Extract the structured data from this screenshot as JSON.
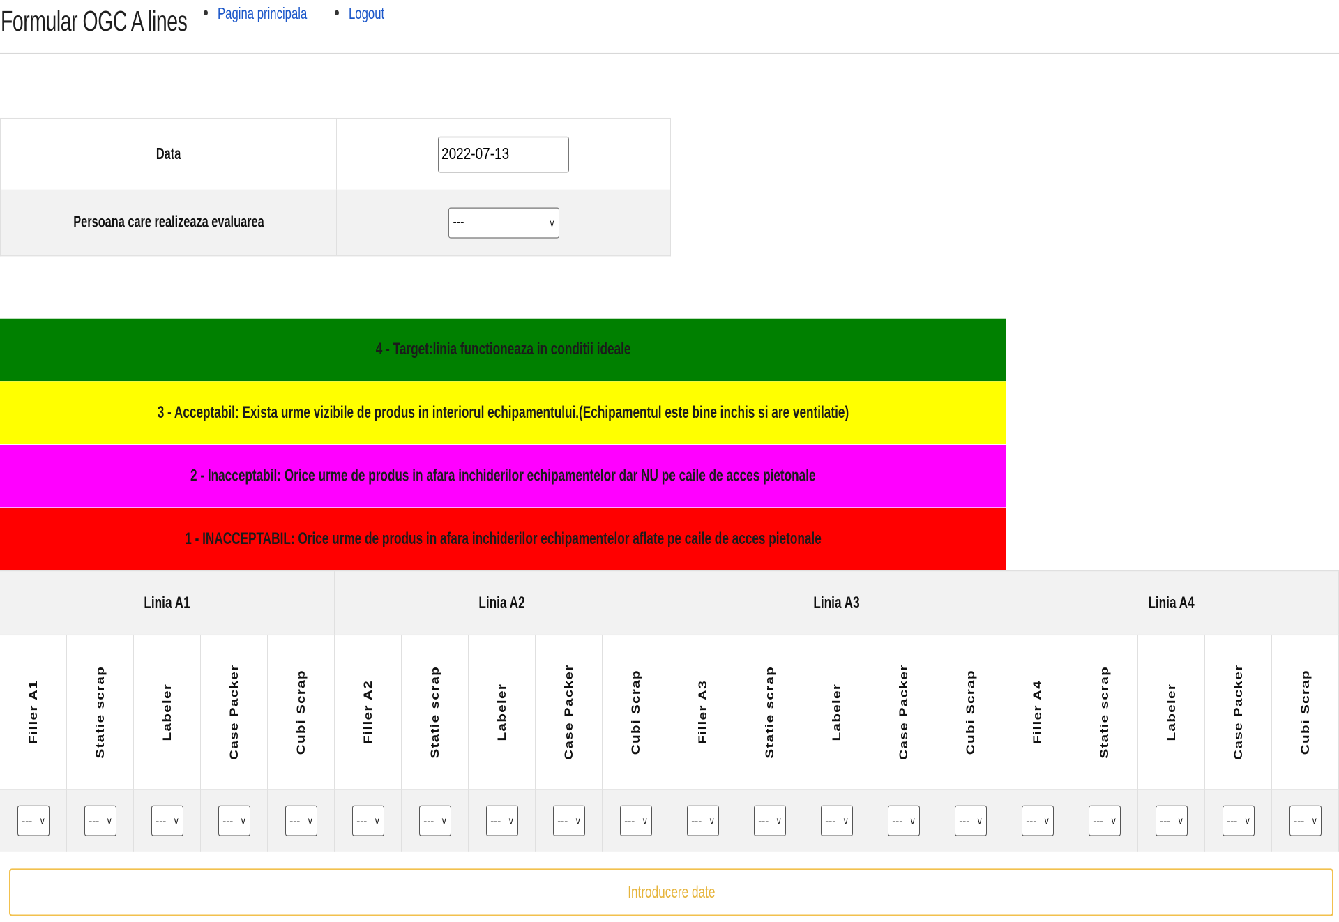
{
  "header": {
    "title": "Formular OGC A lines",
    "nav": [
      {
        "label": "Pagina principala"
      },
      {
        "label": "Logout"
      }
    ]
  },
  "form": {
    "date_label": "Data",
    "date_value": "2022-07-13",
    "person_label": "Persoana care realizeaza evaluarea",
    "person_selected": "---"
  },
  "legend": [
    {
      "text": "4 - Target:linia functioneaza in conditii ideale",
      "color": "#008000"
    },
    {
      "text": "3 - Acceptabil: Exista urme vizibile de produs in interiorul echipamentului.(Echipamentul este bine inchis si are ventilatie)",
      "color": "#ffff00"
    },
    {
      "text": "2 - Inacceptabil: Orice urme de produs in afara inchiderilor echipamentelor dar NU pe caile de acces pietonale",
      "color": "#ff00ff"
    },
    {
      "text": "1 - INACCEPTABIL: Orice urme de produs in afara inchiderilor echipamentelor aflate pe caile de acces pietonale",
      "color": "#ff0000"
    }
  ],
  "lines": [
    {
      "name": "Linia A1",
      "columns": [
        "Filler A1",
        "Statie scrap",
        "Labeler",
        "Case Packer",
        "Cubi Scrap"
      ]
    },
    {
      "name": "Linia A2",
      "columns": [
        "Filler A2",
        "Statie scrap",
        "Labeler",
        "Case Packer",
        "Cubi Scrap"
      ]
    },
    {
      "name": "Linia A3",
      "columns": [
        "Filler A3",
        "Statie scrap",
        "Labeler",
        "Case Packer",
        "Cubi Scrap"
      ]
    },
    {
      "name": "Linia A4",
      "columns": [
        "Filler A4",
        "Statie scrap",
        "Labeler",
        "Case Packer",
        "Cubi Scrap"
      ]
    }
  ],
  "select_placeholder": "---",
  "select_chevron": "v",
  "submit_label": "Introducere date"
}
